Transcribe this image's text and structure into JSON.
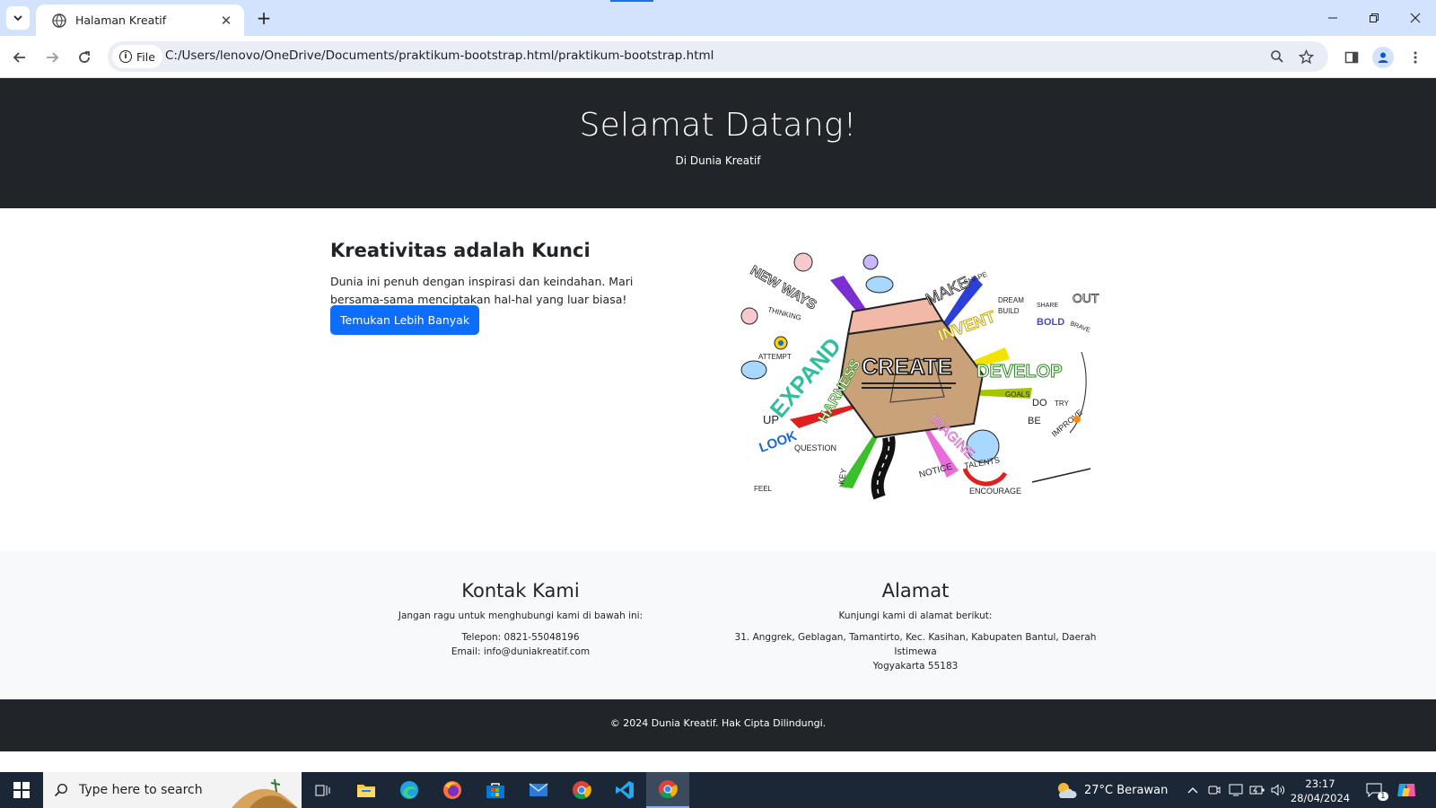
{
  "browser": {
    "tab_title": "Halaman Kreatif",
    "chip_label": "File",
    "url": "C:/Users/lenovo/OneDrive/Documents/praktikum-bootstrap.html/praktikum-bootstrap.html"
  },
  "hero": {
    "title": "Selamat Datang!",
    "subtitle": "Di Dunia Kreatif"
  },
  "feature": {
    "heading": "Kreativitas adalah Kunci",
    "text": "Dunia ini penuh dengan inspirasi dan keindahan. Mari bersama-sama menciptakan hal-hal yang luar biasa!",
    "button_label": "Temukan Lebih Banyak",
    "image_words": [
      "NEW WAYS",
      "THINKING",
      "ATTEMPT",
      "EXPAND",
      "CREATE",
      "INVENT",
      "MAKE",
      "DEVELOP",
      "BOLD",
      "OUT",
      "LOOK",
      "QUESTION",
      "NOTICE",
      "IMAGINE",
      "DO",
      "BE",
      "UP",
      "FEEL",
      "KEY",
      "GOALS",
      "IMPROVE",
      "TRY",
      "DREAM",
      "BUILD",
      "SHAPE",
      "SHARE",
      "BRAVE",
      "TALENTS",
      "ENCOURAGE"
    ]
  },
  "contact": {
    "heading": "Kontak Kami",
    "subtitle": "Jangan ragu untuk menghubungi kami di bawah ini:",
    "phone": "Telepon: 0821-55048196",
    "email": "Email: info@duniakreatif.com"
  },
  "address": {
    "heading": "Alamat",
    "subtitle": "Kunjungi kami di alamat berikut:",
    "line1": "31. Anggrek, Geblagan, Tamantirto, Kec. Kasihan, Kabupaten Bantul, Daerah Istimewa",
    "line2": "Yogyakarta 55183"
  },
  "footer": {
    "text": "© 2024 Dunia Kreatif. Hak Cipta Dilindungi."
  },
  "taskbar": {
    "search_placeholder": "Type here to search",
    "weather": "27°C  Berawan",
    "time": "23:17",
    "date": "28/04/2024",
    "notification_count": "1"
  },
  "colors": {
    "dark": "#212529",
    "primary": "#0d6efd",
    "light": "#f8f9fa",
    "tabbar": "#d3e3fd"
  }
}
